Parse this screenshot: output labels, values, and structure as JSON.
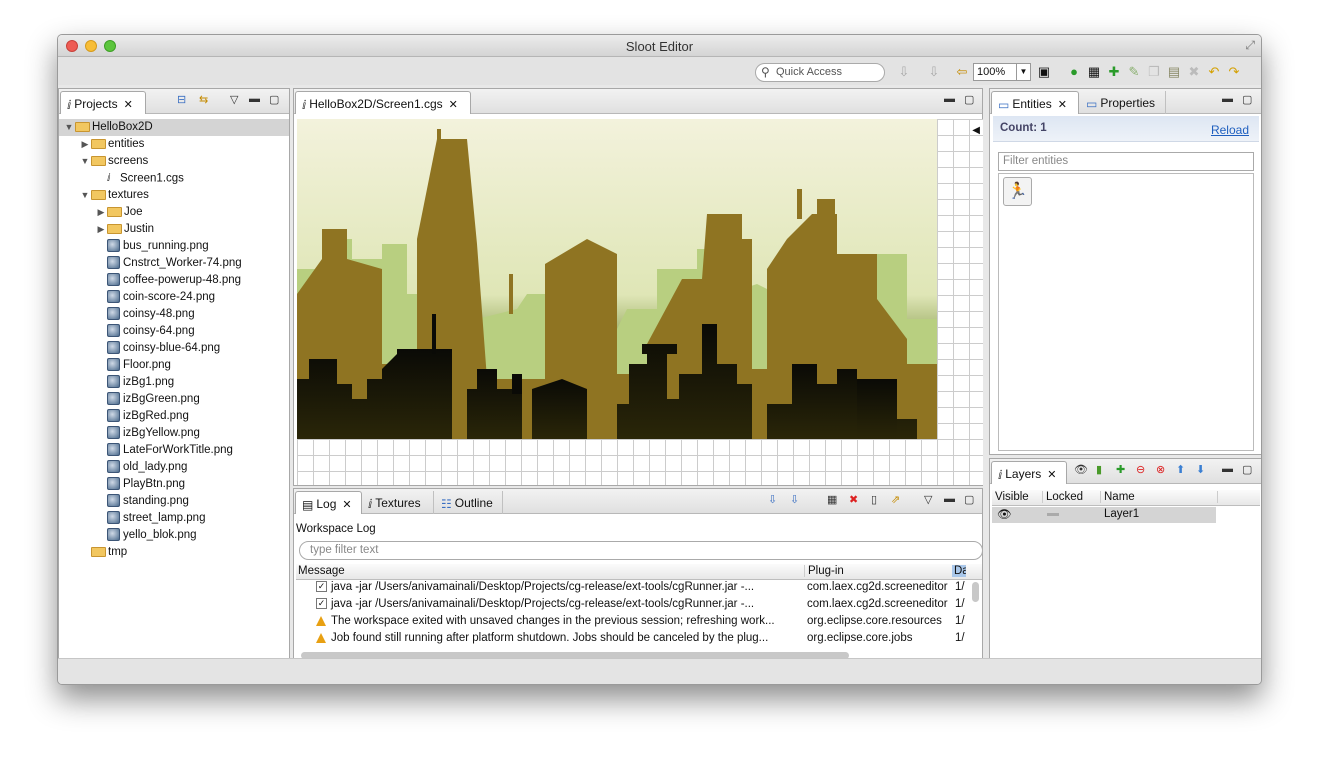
{
  "window": {
    "title": "Sloot Editor"
  },
  "toolbar": {
    "quick_access_placeholder": "Quick Access",
    "zoom": "100%"
  },
  "projects": {
    "tab_label": "Projects",
    "tree": [
      {
        "label": "HelloBox2D",
        "kind": "project",
        "depth": 0,
        "expanded": true,
        "selected": true
      },
      {
        "label": "entities",
        "kind": "folder",
        "depth": 1,
        "expanded": false
      },
      {
        "label": "screens",
        "kind": "folder",
        "depth": 1,
        "expanded": true
      },
      {
        "label": "Screen1.cgs",
        "kind": "cgs",
        "depth": 2
      },
      {
        "label": "textures",
        "kind": "folder",
        "depth": 1,
        "expanded": true
      },
      {
        "label": "Joe",
        "kind": "folder",
        "depth": 2,
        "expanded": false
      },
      {
        "label": "Justin",
        "kind": "folder",
        "depth": 2,
        "expanded": false
      },
      {
        "label": "bus_running.png",
        "kind": "png",
        "depth": 2
      },
      {
        "label": "Cnstrct_Worker-74.png",
        "kind": "png",
        "depth": 2
      },
      {
        "label": "coffee-powerup-48.png",
        "kind": "png",
        "depth": 2
      },
      {
        "label": "coin-score-24.png",
        "kind": "png",
        "depth": 2
      },
      {
        "label": "coinsy-48.png",
        "kind": "png",
        "depth": 2
      },
      {
        "label": "coinsy-64.png",
        "kind": "png",
        "depth": 2
      },
      {
        "label": "coinsy-blue-64.png",
        "kind": "png",
        "depth": 2
      },
      {
        "label": "Floor.png",
        "kind": "png",
        "depth": 2
      },
      {
        "label": "izBg1.png",
        "kind": "png",
        "depth": 2
      },
      {
        "label": "izBgGreen.png",
        "kind": "png",
        "depth": 2
      },
      {
        "label": "izBgRed.png",
        "kind": "png",
        "depth": 2
      },
      {
        "label": "izBgYellow.png",
        "kind": "png",
        "depth": 2
      },
      {
        "label": "LateForWorkTitle.png",
        "kind": "png",
        "depth": 2
      },
      {
        "label": "old_lady.png",
        "kind": "png",
        "depth": 2
      },
      {
        "label": "PlayBtn.png",
        "kind": "png",
        "depth": 2
      },
      {
        "label": "standing.png",
        "kind": "png",
        "depth": 2
      },
      {
        "label": "street_lamp.png",
        "kind": "png",
        "depth": 2
      },
      {
        "label": "yello_blok.png",
        "kind": "png",
        "depth": 2
      },
      {
        "label": "tmp",
        "kind": "folder",
        "depth": 1,
        "expanded": null
      }
    ]
  },
  "editor": {
    "tab_label": "HelloBox2D/Screen1.cgs"
  },
  "bottom": {
    "tabs": [
      "Log",
      "Textures",
      "Outline"
    ],
    "log_title": "Workspace Log",
    "filter_placeholder": "type filter text",
    "columns": [
      "Message",
      "Plug-in",
      "Da"
    ],
    "rows": [
      {
        "icon": "check",
        "message": "java -jar /Users/anivamainali/Desktop/Projects/cg-release/ext-tools/cgRunner.jar -...",
        "plugin": "com.laex.cg2d.screeneditor",
        "date": "1/"
      },
      {
        "icon": "check",
        "message": "java -jar /Users/anivamainali/Desktop/Projects/cg-release/ext-tools/cgRunner.jar -...",
        "plugin": "com.laex.cg2d.screeneditor",
        "date": "1/"
      },
      {
        "icon": "warning",
        "message": "The workspace exited with unsaved changes in the previous session; refreshing work...",
        "plugin": "org.eclipse.core.resources",
        "date": "1/"
      },
      {
        "icon": "warning",
        "message": "Job found still running after platform shutdown.  Jobs should be canceled by the plug...",
        "plugin": "org.eclipse.core.jobs",
        "date": "1/"
      }
    ]
  },
  "entities": {
    "tabs": [
      "Entities",
      "Properties"
    ],
    "count": "Count: 1",
    "reload": "Reload",
    "filter_placeholder": "Filter entities"
  },
  "layers": {
    "tab_label": "Layers",
    "columns": [
      "Visible",
      "Locked",
      "Name"
    ],
    "rows": [
      {
        "name": "Layer1"
      }
    ]
  },
  "colors": {
    "folder": "#f2c760",
    "selection": "#d4d4d4",
    "link": "#1f5fbf"
  }
}
